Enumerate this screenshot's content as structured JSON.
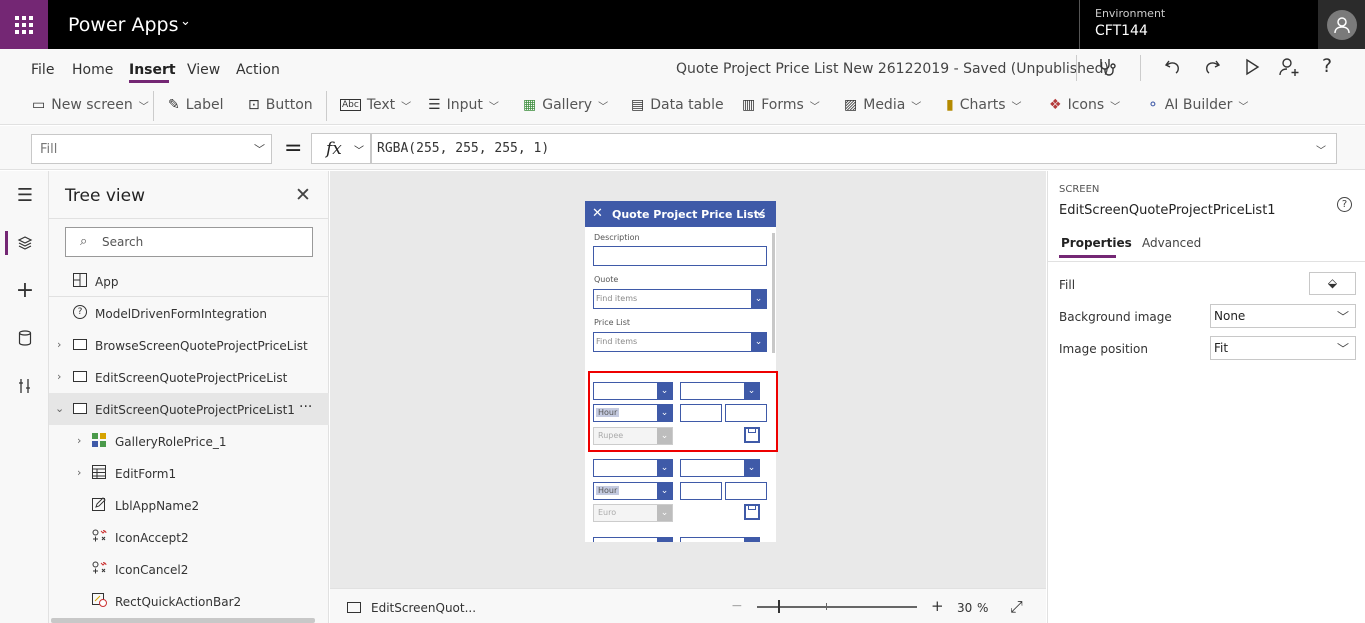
{
  "app": {
    "name": "Power Apps"
  },
  "environment": {
    "label": "Environment",
    "value": "CFT144"
  },
  "menu": {
    "items": [
      "File",
      "Home",
      "Insert",
      "View",
      "Action"
    ],
    "active": "Insert"
  },
  "document": {
    "title": "Quote Project Price List New 26122019 - Saved (Unpublished)"
  },
  "ribbon": {
    "new_screen": "New screen",
    "label": "Label",
    "button": "Button",
    "text": "Text",
    "input": "Input",
    "gallery": "Gallery",
    "data_table": "Data table",
    "forms": "Forms",
    "media": "Media",
    "charts": "Charts",
    "icons": "Icons",
    "ai_builder": "AI Builder"
  },
  "formula_bar": {
    "property": "Fill",
    "equals": "=",
    "fx": "fx",
    "formula": "RGBA(255, 255, 255, 1)"
  },
  "tree": {
    "title": "Tree view",
    "search_placeholder": "Search",
    "nodes": [
      {
        "label": "App"
      },
      {
        "label": "ModelDrivenFormIntegration"
      },
      {
        "label": "BrowseScreenQuoteProjectPriceList"
      },
      {
        "label": "EditScreenQuoteProjectPriceList"
      },
      {
        "label": "EditScreenQuoteProjectPriceList1"
      },
      {
        "label": "GalleryRolePrice_1"
      },
      {
        "label": "EditForm1"
      },
      {
        "label": "LblAppName2"
      },
      {
        "label": "IconAccept2"
      },
      {
        "label": "IconCancel2"
      },
      {
        "label": "RectQuickActionBar2"
      }
    ],
    "more": "···"
  },
  "phone": {
    "title": "Quote Project Price Lists",
    "description_label": "Description",
    "quote_label": "Quote",
    "quote_placeholder": "Find items",
    "pricelist_label": "Price List",
    "pricelist_placeholder": "Find items",
    "unit1": "Hour",
    "currency1": "Rupee",
    "unit2": "Hour",
    "currency2": "Euro"
  },
  "bottom": {
    "screen": "EditScreenQuot...",
    "zoom": "30",
    "zoom_unit": "%",
    "minus": "−",
    "plus": "+"
  },
  "properties": {
    "kind": "SCREEN",
    "name": "EditScreenQuoteProjectPriceList1",
    "tab_properties": "Properties",
    "tab_advanced": "Advanced",
    "fill_label": "Fill",
    "bg_label": "Background image",
    "bg_value": "None",
    "pos_label": "Image position",
    "pos_value": "Fit"
  },
  "colors": {
    "brand": "#742774",
    "phone_header": "#3f5aa8",
    "highlight": "#e00000"
  }
}
